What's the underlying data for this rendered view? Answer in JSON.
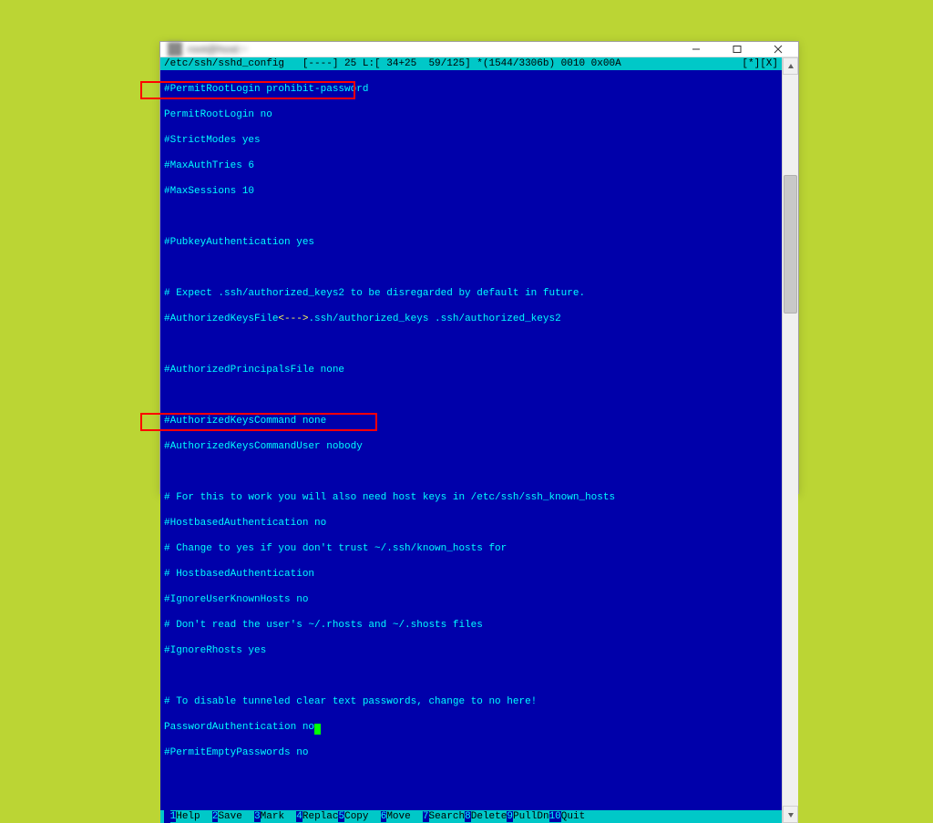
{
  "window": {
    "title": "root@host:~"
  },
  "status": {
    "file": "/etc/ssh/sshd_config",
    "info": "   [----] 25 L:[ 34+25  59/125] *(1544/3306b) 0010 0x00A",
    "right": "[*][X]"
  },
  "lines": [
    "#PermitRootLogin prohibit-password",
    "PermitRootLogin no",
    "#StrictModes yes",
    "#MaxAuthTries 6",
    "#MaxSessions 10",
    "",
    "#PubkeyAuthentication yes",
    "",
    "# Expect .ssh/authorized_keys2 to be disregarded by default in future.",
    "#AuthorizedKeysFile",
    ".ssh/authorized_keys .ssh/authorized_keys2",
    "",
    "#AuthorizedPrincipalsFile none",
    "",
    "#AuthorizedKeysCommand none",
    "#AuthorizedKeysCommandUser nobody",
    "",
    "# For this to work you will also need host keys in /etc/ssh/ssh_known_hosts",
    "#HostbasedAuthentication no",
    "# Change to yes if you don't trust ~/.ssh/known_hosts for",
    "# HostbasedAuthentication",
    "#IgnoreUserKnownHosts no",
    "# Don't read the user's ~/.rhosts and ~/.shosts files",
    "#IgnoreRhosts yes",
    "",
    "# To disable tunneled clear text passwords, change to no here!",
    "PasswordAuthentication no",
    "#PermitEmptyPasswords no",
    ""
  ],
  "auth_keys_marker": "<--->",
  "fnkeys": [
    {
      "n": "1",
      "label": "Help  "
    },
    {
      "n": "2",
      "label": "Save  "
    },
    {
      "n": "3",
      "label": "Mark  "
    },
    {
      "n": "4",
      "label": "Replac"
    },
    {
      "n": "5",
      "label": "Copy  "
    },
    {
      "n": "6",
      "label": "Move  "
    },
    {
      "n": "7",
      "label": "Search"
    },
    {
      "n": "8",
      "label": "Delete"
    },
    {
      "n": "9",
      "label": "PullDn"
    },
    {
      "n": "10",
      "label": "Quit "
    }
  ]
}
